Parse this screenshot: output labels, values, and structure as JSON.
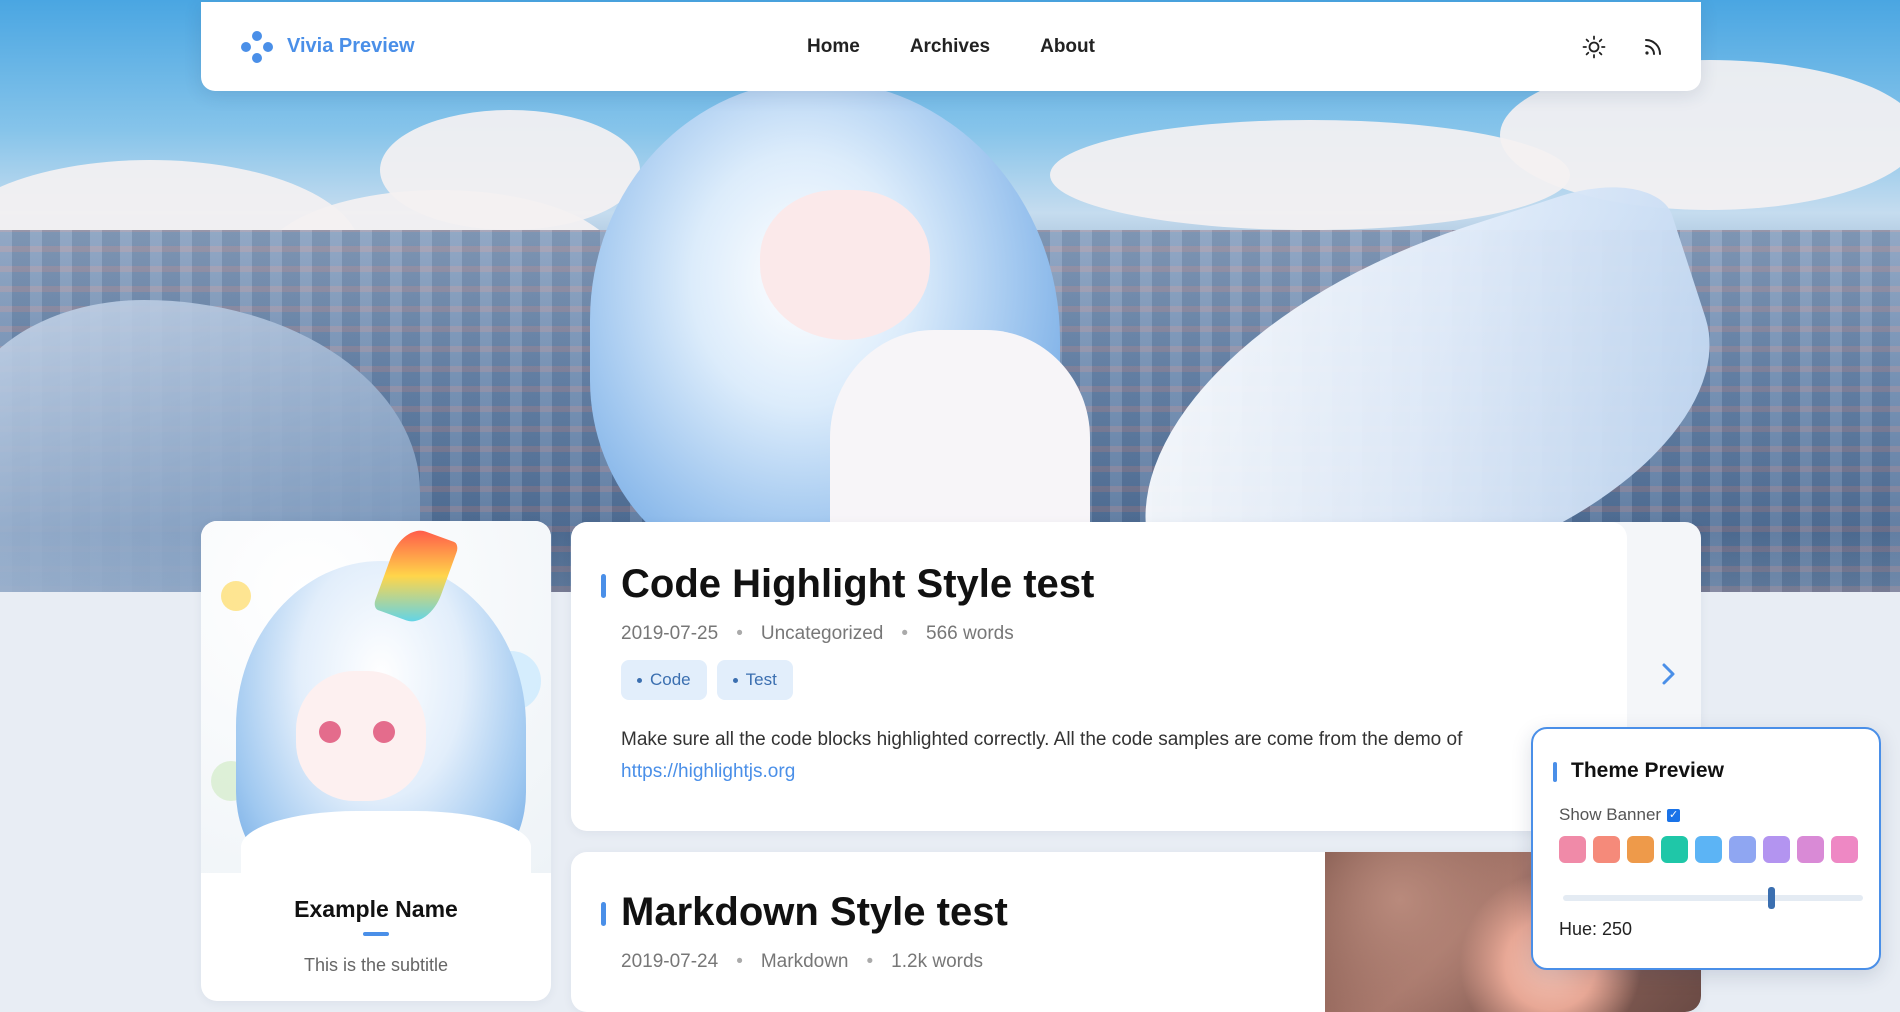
{
  "header": {
    "brand_name": "Vivia Preview",
    "brand_icon": "four-dots-logo-icon",
    "nav": [
      {
        "label": "Home"
      },
      {
        "label": "Archives"
      },
      {
        "label": "About"
      }
    ],
    "icons": [
      "sun-icon",
      "rss-icon"
    ]
  },
  "profile": {
    "name": "Example Name",
    "subtitle": "This is the subtitle"
  },
  "posts": [
    {
      "title": "Code Highlight Style test",
      "date": "2019-07-25",
      "category": "Uncategorized",
      "words": "566 words",
      "tags": [
        "Code",
        "Test"
      ],
      "excerpt": "Make sure all the code blocks highlighted correctly. All the code samples are come from the demo of",
      "excerpt_link": "https://highlightjs.org"
    },
    {
      "title": "Markdown Style test",
      "date": "2019-07-24",
      "category": "Markdown",
      "words": "1.2k words"
    }
  ],
  "theme_panel": {
    "title": "Theme Preview",
    "show_banner_label": "Show Banner",
    "show_banner_checked": true,
    "swatches": [
      "#f08aa8",
      "#f58a7a",
      "#ee9a4a",
      "#1fc7a8",
      "#5cb4f5",
      "#8fa6f2",
      "#b394f0",
      "#d98ad6",
      "#ee88c4"
    ],
    "hue_label": "Hue: 250",
    "hue_value": 250,
    "hue_max": 360
  },
  "colors": {
    "accent": "#4a8fe8",
    "page_bg": "#e8edf4",
    "tag_bg": "#e2eefb"
  }
}
